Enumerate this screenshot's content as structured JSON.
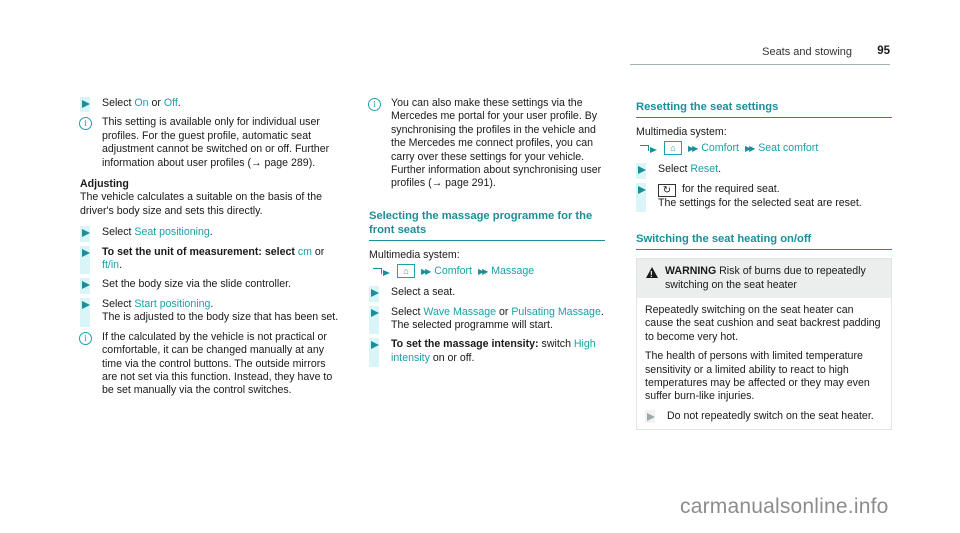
{
  "header": {
    "section_title": "Seats and stowing",
    "page_number": "95"
  },
  "col1": {
    "step_select": {
      "prefix": "Select ",
      "on": "On",
      "or": " or ",
      "off": "Off",
      "suffix": "."
    },
    "info1": "This setting is available only for individual user profiles. For the guest profile, automatic seat adjustment cannot be switched on or off. Further information about user profiles (→ page 289).",
    "adjusting_heading": "Adjusting",
    "adjusting_text": "The vehicle calculates a suitable on the basis of the driver's body size and sets this directly.",
    "step_seat_pos": {
      "prefix": "Select ",
      "link": "Seat positioning",
      "suffix": "."
    },
    "step_unit": {
      "bold": "To set the unit of measurement: select ",
      "cm": "cm",
      "or": " or ",
      "ftin": "ft/in",
      "suffix": "."
    },
    "step_slider": "Set the body size via the slide controller.",
    "step_start": {
      "prefix": "Select ",
      "link": "Start positioning",
      "suffix": ".",
      "result": "The is adjusted to the body size that has been set."
    },
    "info2": "If the calculated by the vehicle is not practical or comfortable, it can be changed manually at any time via the control buttons. The outside mirrors are not set via this function. Instead, they have to be set manually via the control switches."
  },
  "col2": {
    "info": "You can also make these settings via the Mercedes me portal for your user profile. By synchronising the profiles in the vehicle and the Mercedes me connect profiles, you can carry over these settings for your vehicle. Further information about synchronising user profiles (→ page 291).",
    "massage_title": "Selecting the massage programme for the front seats",
    "multimedia_label": "Multimedia system:",
    "path": [
      "Comfort",
      "Massage"
    ],
    "step_seat": "Select a seat.",
    "step_programme": {
      "prefix": "Select ",
      "wave": "Wave Massage",
      "or": " or ",
      "pulsating": "Pulsating Massage",
      "suffix": ".",
      "result": "The selected programme will start."
    },
    "step_intensity": {
      "bold": "To set the massage intensity:",
      "mid": " switch ",
      "link": "High intensity",
      "suffix": " on or off."
    }
  },
  "col3": {
    "reset_title": "Resetting the seat settings",
    "multimedia_label": "Multimedia system:",
    "path": [
      "Comfort",
      "Seat comfort"
    ],
    "step_reset": {
      "prefix": "Select ",
      "link": "Reset",
      "suffix": "."
    },
    "step_button": {
      "text": " for the required seat.",
      "result": "The settings for the selected seat are reset."
    },
    "heating_title": "Switching the seat heating on/off",
    "warning": {
      "label": "WARNING",
      "title": " Risk of burns due to repeatedly switching on the seat heater",
      "para1": "Repeatedly switching on the seat heater can cause the seat cushion and seat backrest padding to become very hot.",
      "para2": "The health of persons with limited temperature sensitivity or a limited ability to react to high temperatures may be affected or they may even suffer burn-like injuries.",
      "step": "Do not repeatedly switch on the seat heater."
    }
  },
  "watermark": "carmanualsonline.info",
  "colors": {
    "accent": "#1a9fa8",
    "step_bar": "#d9f5f7",
    "warning_bg": "#eceeee"
  }
}
